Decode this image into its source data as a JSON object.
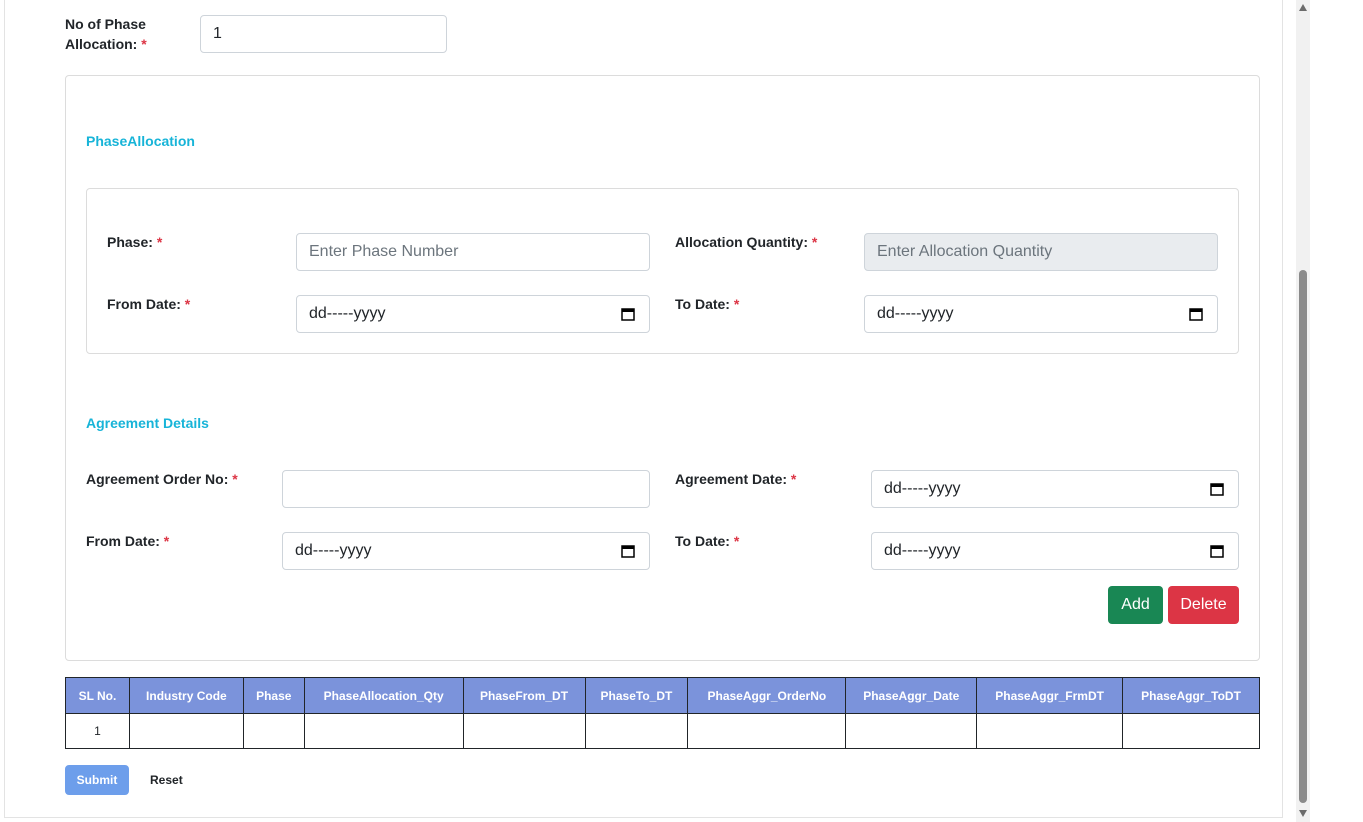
{
  "phase_count": {
    "label": "No of Phase",
    "label_line2": "Allocation:",
    "required": "*",
    "value": "1"
  },
  "phase_allocation": {
    "title": "PhaseAllocation",
    "phase_label": "Phase:",
    "phase_placeholder": "Enter Phase Number",
    "qty_label": "Allocation Quantity:",
    "qty_placeholder": "Enter Allocation Quantity",
    "from_label": "From Date:",
    "from_value": "dd-----yyyy",
    "to_label": "To Date:",
    "to_value": "dd-----yyyy"
  },
  "agreement": {
    "title": "Agreement Details",
    "order_label": "Agreement Order No:",
    "order_value": "",
    "date_label": "Agreement Date:",
    "date_value": "dd-----yyyy",
    "from_label": "From Date:",
    "from_value": "dd-----yyyy",
    "to_label": "To Date:",
    "to_value": "dd-----yyyy",
    "add_label": "Add",
    "delete_label": "Delete"
  },
  "required_mark": "*",
  "table": {
    "headers": [
      "SL No.",
      "Industry Code",
      "Phase",
      "PhaseAllocation_Qty",
      "PhaseFrom_DT",
      "PhaseTo_DT",
      "PhaseAggr_OrderNo",
      "PhaseAggr_Date",
      "PhaseAggr_FrmDT",
      "PhaseAggr_ToDT"
    ],
    "rows": [
      [
        "1",
        "",
        "",
        "",
        "",
        "",
        "",
        "",
        "",
        ""
      ]
    ]
  },
  "actions": {
    "submit_label": "Submit",
    "reset_label": "Reset"
  },
  "colors": {
    "section_title": "#17b4d8",
    "table_header": "#7b93db",
    "add_button": "#198754",
    "delete_button": "#dc3545",
    "submit_button": "#6d9eeb"
  }
}
